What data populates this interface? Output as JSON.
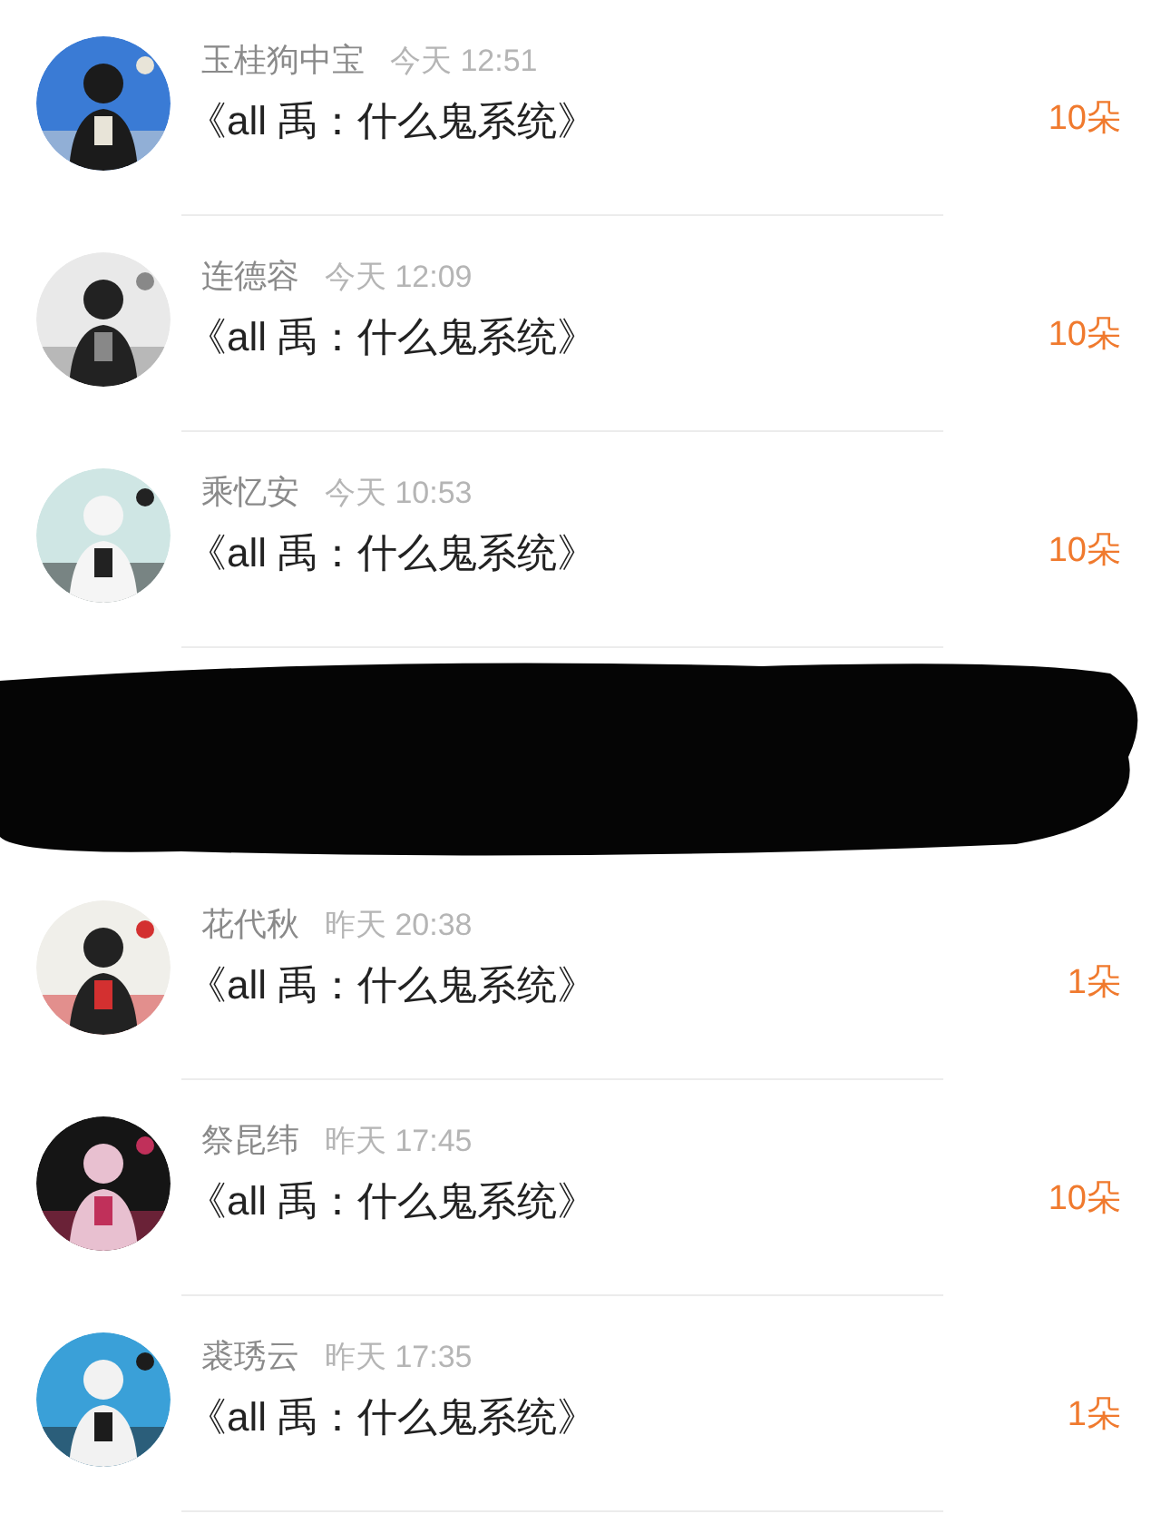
{
  "messages": [
    {
      "kind": "gift",
      "name": "玉桂狗中宝",
      "time": "今天 12:51",
      "title": "《all 禹：什么鬼系统》",
      "count": "10朵"
    },
    {
      "kind": "gift",
      "name": "连德容",
      "time": "今天 12:09",
      "title": "《all 禹：什么鬼系统》",
      "count": "10朵"
    },
    {
      "kind": "gift",
      "name": "乘忆安",
      "time": "今天 10:53",
      "title": "《all 禹：什么鬼系统》",
      "count": "10朵"
    },
    {
      "kind": "redacted"
    },
    {
      "kind": "gift",
      "name": "花代秋",
      "time": "昨天 20:38",
      "title": "《all 禹：什么鬼系统》",
      "count": "1朵"
    },
    {
      "kind": "gift",
      "name": "祭昆纬",
      "time": "昨天 17:45",
      "title": "《all 禹：什么鬼系统》",
      "count": "10朵"
    },
    {
      "kind": "gift",
      "name": "裘琇云",
      "time": "昨天 17:35",
      "title": "《all 禹：什么鬼系统》",
      "count": "1朵"
    }
  ]
}
